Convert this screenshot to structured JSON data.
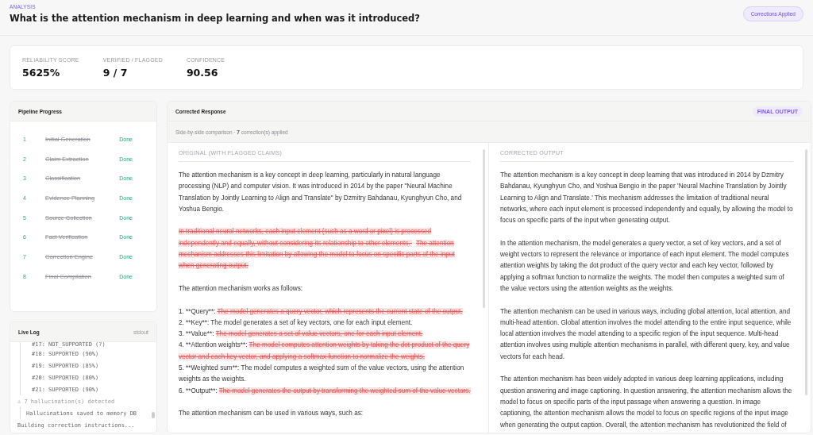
{
  "header": {
    "eyebrow": "ANALYSIS",
    "title": "What is the attention mechanism in deep learning and when was it introduced?",
    "badge": "Corrections Applied"
  },
  "stats": [
    {
      "label": "RELIABILITY SCORE",
      "value": "5625%"
    },
    {
      "label": "VERIFIED / FLAGGED",
      "value": "9 / 7"
    },
    {
      "label": "CONFIDENCE",
      "value": "90.56"
    }
  ],
  "pipeline": {
    "title": "Pipeline Progress",
    "steps": [
      {
        "number": "1",
        "name": "Initial Generation",
        "status": "Done",
        "completed": true
      },
      {
        "number": "2",
        "name": "Claim Extraction",
        "status": "Done",
        "completed": true
      },
      {
        "number": "3",
        "name": "Classification",
        "status": "Done",
        "completed": true
      },
      {
        "number": "4",
        "name": "Evidence Planning",
        "status": "Done",
        "completed": true
      },
      {
        "number": "5",
        "name": "Source Collection",
        "status": "Done",
        "completed": true
      },
      {
        "number": "6",
        "name": "Fact Verification",
        "status": "Done",
        "completed": true
      },
      {
        "number": "7",
        "name": "Correction Engine",
        "status": "Done",
        "completed": true
      },
      {
        "number": "8",
        "name": "Final Compilation",
        "status": "Done",
        "completed": true
      }
    ]
  },
  "log": {
    "title": "Live Log",
    "tag": "stdout",
    "lines": [
      {
        "kind": "result",
        "text": "#17: NOT_SUPPORTED (?)"
      },
      {
        "kind": "result",
        "text": "#18: SUPPORTED (90%)"
      },
      {
        "kind": "result",
        "text": "#19: SUPPORTED (85%)"
      },
      {
        "kind": "result",
        "text": "#20: SUPPORTED (80%)"
      },
      {
        "kind": "result",
        "text": "#21: SUPPORTED (90%)"
      },
      {
        "kind": "warning",
        "icon": "⚠",
        "text": "7 hallucination(s) detected"
      },
      {
        "kind": "note",
        "text": "Hallucinations saved to memory DB"
      },
      {
        "kind": "info",
        "text": "Building correction instructions..."
      }
    ]
  },
  "response": {
    "title": "Corrected Response",
    "badge": "FINAL OUTPUT",
    "subtitle": "Side-by-side comparison · **7** correction(s) applied",
    "original": {
      "heading": "ORIGINAL (WITH FLAGGED CLAIMS)",
      "blocks": [
        {
          "kind": "paragraph",
          "segments": [
            {
              "text": "The attention mechanism is a key concept in deep learning, particularly in natural language processing (NLP) and computer vision. It was introduced in 2014 by the paper \"Neural Machine Translation by Jointly Learning to Align and Translate\" by Dzmitry Bahdanau, Kyunghyun Cho, and Yoshua Bengio.",
              "flagged": false
            }
          ]
        },
        {
          "kind": "paragraph",
          "segments": [
            {
              "text": " In traditional neural networks, each input element (such as a word or pixel) is processed independently and equally, without considering its relationship to other elements. ",
              "flagged": true
            },
            {
              "text": " The attention mechanism addresses this limitation by allowing the model to focus on specific parts of the input when generating output.",
              "flagged": true
            }
          ]
        },
        {
          "kind": "paragraph",
          "segments": [
            {
              "text": "The attention mechanism works as follows:",
              "flagged": false
            }
          ]
        },
        {
          "kind": "list",
          "items": [
            [
              {
                "text": "1. **Query**: ",
                "flagged": false
              },
              {
                "text": " The model generates a query vector, which represents the current state of the output.",
                "flagged": true
              }
            ],
            [
              {
                "text": "2. **Key**: The model generates a set of key vectors, one for each input element.",
                "flagged": false
              }
            ],
            [
              {
                "text": "3. **Value**: ",
                "flagged": false
              },
              {
                "text": " The model generates a set of value vectors, one for each input element.",
                "flagged": true
              }
            ],
            [
              {
                "text": "4. **Attention weights**: ",
                "flagged": false
              },
              {
                "text": " The model computes attention weights by taking the dot product of the query vector and each key vector, and applying a softmax function to normalize the weights.",
                "flagged": true
              }
            ],
            [
              {
                "text": "5. **Weighted sum**: The model computes a weighted sum of the value vectors, using the attention weights as the weights.",
                "flagged": false
              }
            ],
            [
              {
                "text": "6. **Output**: ",
                "flagged": false
              },
              {
                "text": " The model generates the output by transforming the weighted sum of the value vectors.",
                "flagged": true
              }
            ]
          ]
        },
        {
          "kind": "paragraph",
          "segments": [
            {
              "text": "The attention mechanism can be used in various ways, such as:",
              "flagged": false
            }
          ]
        }
      ]
    },
    "corrected": {
      "heading": "CORRECTED OUTPUT",
      "paragraphs": [
        "The attention mechanism is a key concept in deep learning that was introduced in 2014 by Dzmitry Bahdanau, Kyunghyun Cho, and Yoshua Bengio in the paper 'Neural Machine Translation by Jointly Learning to Align and Translate.' This mechanism addresses the limitation of traditional neural networks, where each input element is processed independently and equally, by allowing the model to focus on specific parts of the input when generating output.",
        "In the attention mechanism, the model generates a query vector, a set of key vectors, and a set of weight vectors to represent the relevance or importance of each input element. The model computes attention weights by taking the dot product of the query vector and each key vector, followed by applying a softmax function to normalize the weights. The model then computes a weighted sum of the value vectors using the attention weights as the weights.",
        "The attention mechanism can be used in various ways, including global attention, local attention, and multi-head attention. Global attention involves the model attending to the entire input sequence, while local attention involves the model attending to a specific region of the input sequence. Multi-head attention involves using multiple attention mechanisms in parallel, with different query, key, and value vectors for each head.",
        "The attention mechanism has been widely adopted in various deep learning applications, including question answering and image captioning. In question answering, the attention mechanism allows the model to focus on specific parts of the input passage when answering a question. In image captioning, the attention mechanism allows the model to focus on specific regions of the input image when generating the output caption. Overall, the attention mechanism has revolutionized the field of"
      ]
    }
  }
}
